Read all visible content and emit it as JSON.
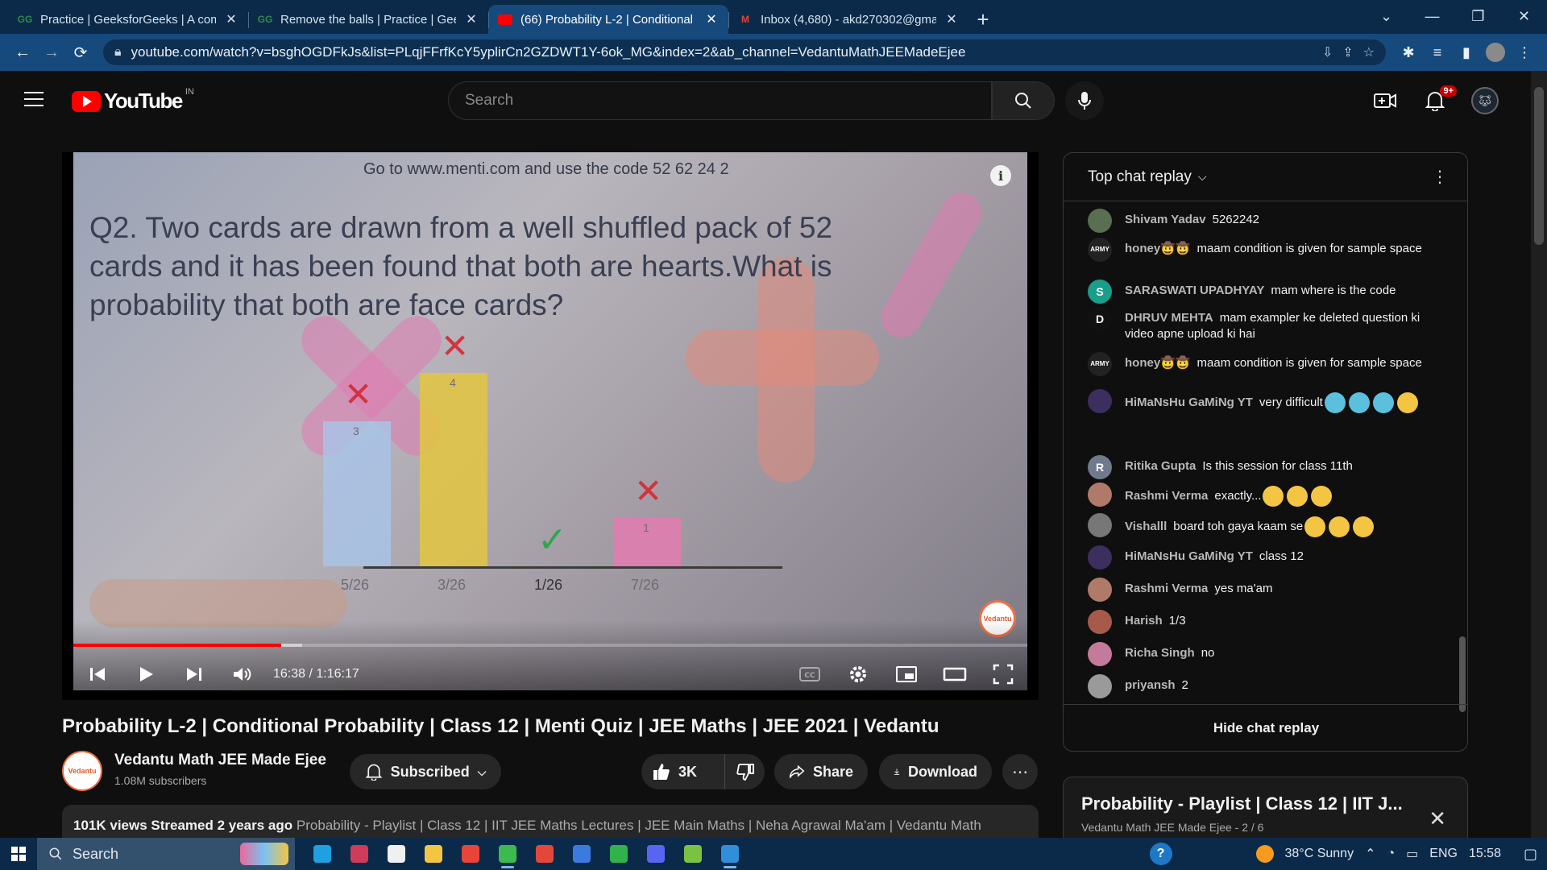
{
  "browser": {
    "tabs": [
      {
        "title": "Practice | GeeksforGeeks | A com",
        "favicon": "gfg-icon",
        "active": false
      },
      {
        "title": "Remove the balls | Practice | Gee",
        "favicon": "gfg-icon",
        "active": false
      },
      {
        "title": "(66) Probability L-2 | Conditional",
        "favicon": "youtube-icon",
        "active": true
      },
      {
        "title": "Inbox (4,680) - akd270302@gma",
        "favicon": "gmail-icon",
        "active": false
      }
    ],
    "url": "youtube.com/watch?v=bsghOGDFkJs&list=PLqjFFrfKcY5yplirCn2GZDWT1Y-6ok_MG&index=2&ab_channel=VedantuMathJEEMadeEjee"
  },
  "masthead": {
    "logo_text": "YouTube",
    "country_code": "IN",
    "search_placeholder": "Search",
    "notification_count": "9+"
  },
  "video_frame": {
    "menti_line": "Go to www.menti.com and use the code 52 62 24 2",
    "question": "Q2. Two cards are drawn from a well shuffled pack of 52 cards and it has been found that both are hearts.What is probability that both are face cards?",
    "bars": [
      {
        "label": "5/26",
        "value": 3,
        "color": "#a9c3e6",
        "mark": "wrong"
      },
      {
        "label": "3/26",
        "value": 4,
        "color": "#e3c640",
        "mark": "wrong"
      },
      {
        "label": "1/26",
        "value": 0,
        "color": "#2ea64e",
        "mark": "correct"
      },
      {
        "label": "7/26",
        "value": 1,
        "color": "#e47bb0",
        "mark": "wrong"
      }
    ],
    "bar_value_labels": [
      "3",
      "4",
      "",
      "1"
    ],
    "brand_bug": "Vedantu"
  },
  "player": {
    "time_current": "16:38",
    "time_total": "1:16:17",
    "time_display": "16:38 / 1:16:17",
    "progress_fraction": 0.218,
    "buffer_fraction": 0.24
  },
  "video": {
    "title": "Probability L-2 | Conditional Probability | Class 12 | Menti Quiz | JEE Maths | JEE 2021 | Vedantu",
    "channel": "Vedantu Math JEE Made Ejee",
    "subscribers": "1.08M subscribers",
    "subscribe_label": "Subscribed",
    "likes": "3K",
    "share_label": "Share",
    "download_label": "Download",
    "views_line": "101K views  Streamed 2 years ago",
    "tags_line": "Probability - Playlist | Class 12 | IIT JEE Maths Lectures | JEE Main Maths | Neha Agrawal Ma'am | Vedantu Math"
  },
  "chat": {
    "header": "Top chat replay",
    "footer": "Hide chat replay",
    "messages": [
      {
        "author": "Shivam Yadav",
        "text": "5262242",
        "avatar_color": "#5a6e52",
        "avatar_text": ""
      },
      {
        "author": "honey🤠🤠",
        "text": "maam condition is given for sample space",
        "avatar_color": "#222222",
        "avatar_text": "ARMY"
      },
      {
        "author": "SARASWATI UPADHYAY",
        "text": "mam where is the code",
        "avatar_color": "#1a9e8a",
        "avatar_text": "S"
      },
      {
        "author": "DHRUV MEHTA",
        "text": "mam exampler ke deleted question ki video apne upload ki hai",
        "avatar_color": "#111111",
        "avatar_text": "D"
      },
      {
        "author": "honey🤠🤠",
        "text": "maam condition is given for sample space",
        "avatar_color": "#222222",
        "avatar_text": "ARMY"
      },
      {
        "author": "HiMaNsHu GaMiNg YT",
        "text": "very difficult",
        "avatar_color": "#3c2e5e",
        "avatar_text": "",
        "emojis": [
          "#5bc0de",
          "#5bc0de",
          "#5bc0de",
          "#f4c542"
        ]
      },
      {
        "author": "Ritika Gupta",
        "text": "Is this session for class 11th",
        "avatar_color": "#6f7a8c",
        "avatar_text": "R"
      },
      {
        "author": "Rashmi Verma",
        "text": "exactly...",
        "avatar_color": "#b07a6a",
        "avatar_text": "",
        "emojis": [
          "#f4c542",
          "#f4c542",
          "#f4c542"
        ]
      },
      {
        "author": "Vishalll",
        "text": "board toh gaya kaam se",
        "avatar_color": "#777777",
        "avatar_text": "",
        "emojis": [
          "#f4c542",
          "#f4c542",
          "#f4c542"
        ]
      },
      {
        "author": "HiMaNsHu GaMiNg YT",
        "text": "class 12",
        "avatar_color": "#3c2e5e",
        "avatar_text": ""
      },
      {
        "author": "Rashmi Verma",
        "text": "yes ma'am",
        "avatar_color": "#b07a6a",
        "avatar_text": ""
      },
      {
        "author": "Harish",
        "text": "1/3",
        "avatar_color": "#a85a4a",
        "avatar_text": ""
      },
      {
        "author": "Richa Singh",
        "text": "no",
        "avatar_color": "#c47a9a",
        "avatar_text": ""
      },
      {
        "author": "priyansh",
        "text": "2",
        "avatar_color": "#9a9a9a",
        "avatar_text": ""
      }
    ]
  },
  "playlist": {
    "title": "Probability - Playlist | Class 12 | IIT J...",
    "meta": "Vedantu Math JEE Made Ejee - 2 / 6"
  },
  "taskbar": {
    "search_placeholder": "Search",
    "weather": "38°C  Sunny",
    "language": "ENG",
    "clock": "15:58",
    "apps": [
      {
        "name": "edge-icon",
        "color": "#1fa0e0",
        "running": false
      },
      {
        "name": "vedantu-app-icon",
        "color": "#d13b5a",
        "running": false
      },
      {
        "name": "store-icon",
        "color": "#f0f0f0",
        "running": false
      },
      {
        "name": "file-explorer-icon",
        "color": "#f4c542",
        "running": false
      },
      {
        "name": "git-icon",
        "color": "#e8443a",
        "running": false
      },
      {
        "name": "chrome-icon",
        "color": "#3dba4e",
        "running": true
      },
      {
        "name": "chrome-profile-icon",
        "color": "#e3473b",
        "running": false
      },
      {
        "name": "teams-icon",
        "color": "#3b7be0",
        "running": false
      },
      {
        "name": "xbox-icon",
        "color": "#2fb34a",
        "running": false
      },
      {
        "name": "discord-icon",
        "color": "#5865f2",
        "running": false
      },
      {
        "name": "bluestacks-icon",
        "color": "#7cc242",
        "running": false
      },
      {
        "name": "vscode-icon",
        "color": "#2f8fd8",
        "running": true
      }
    ]
  }
}
